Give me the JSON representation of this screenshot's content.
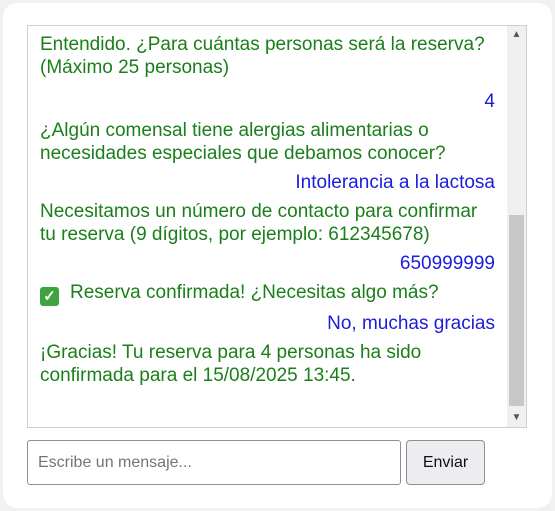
{
  "chat": {
    "messages": [
      {
        "sender": "bot",
        "text": "Entendido. ¿Para cuántas personas será la reserva? (Máximo 25 personas)"
      },
      {
        "sender": "user",
        "text": "4"
      },
      {
        "sender": "bot",
        "text": "¿Algún comensal tiene alergias alimentarias o necesidades especiales que debamos conocer?"
      },
      {
        "sender": "user",
        "text": "Intolerancia a la lactosa"
      },
      {
        "sender": "bot",
        "text": "Necesitamos un número de contacto para confirmar tu reserva (9 dígitos, por ejemplo: 612345678)"
      },
      {
        "sender": "user",
        "text": "650999999"
      },
      {
        "sender": "bot",
        "icon": "check-mark-icon",
        "text": "Reserva confirmada! ¿Necesitas algo más?"
      },
      {
        "sender": "user",
        "text": "No, muchas gracias"
      },
      {
        "sender": "bot",
        "text": "¡Gracias! Tu reserva para 4 personas ha sido confirmada para el 15/08/2025 13:45."
      }
    ]
  },
  "input": {
    "value": "",
    "placeholder": "Escribe un mensaje..."
  },
  "send_button": {
    "label": "Enviar"
  },
  "colors": {
    "bot_text": "#1a7f1a",
    "user_text": "#1c1cdc"
  }
}
